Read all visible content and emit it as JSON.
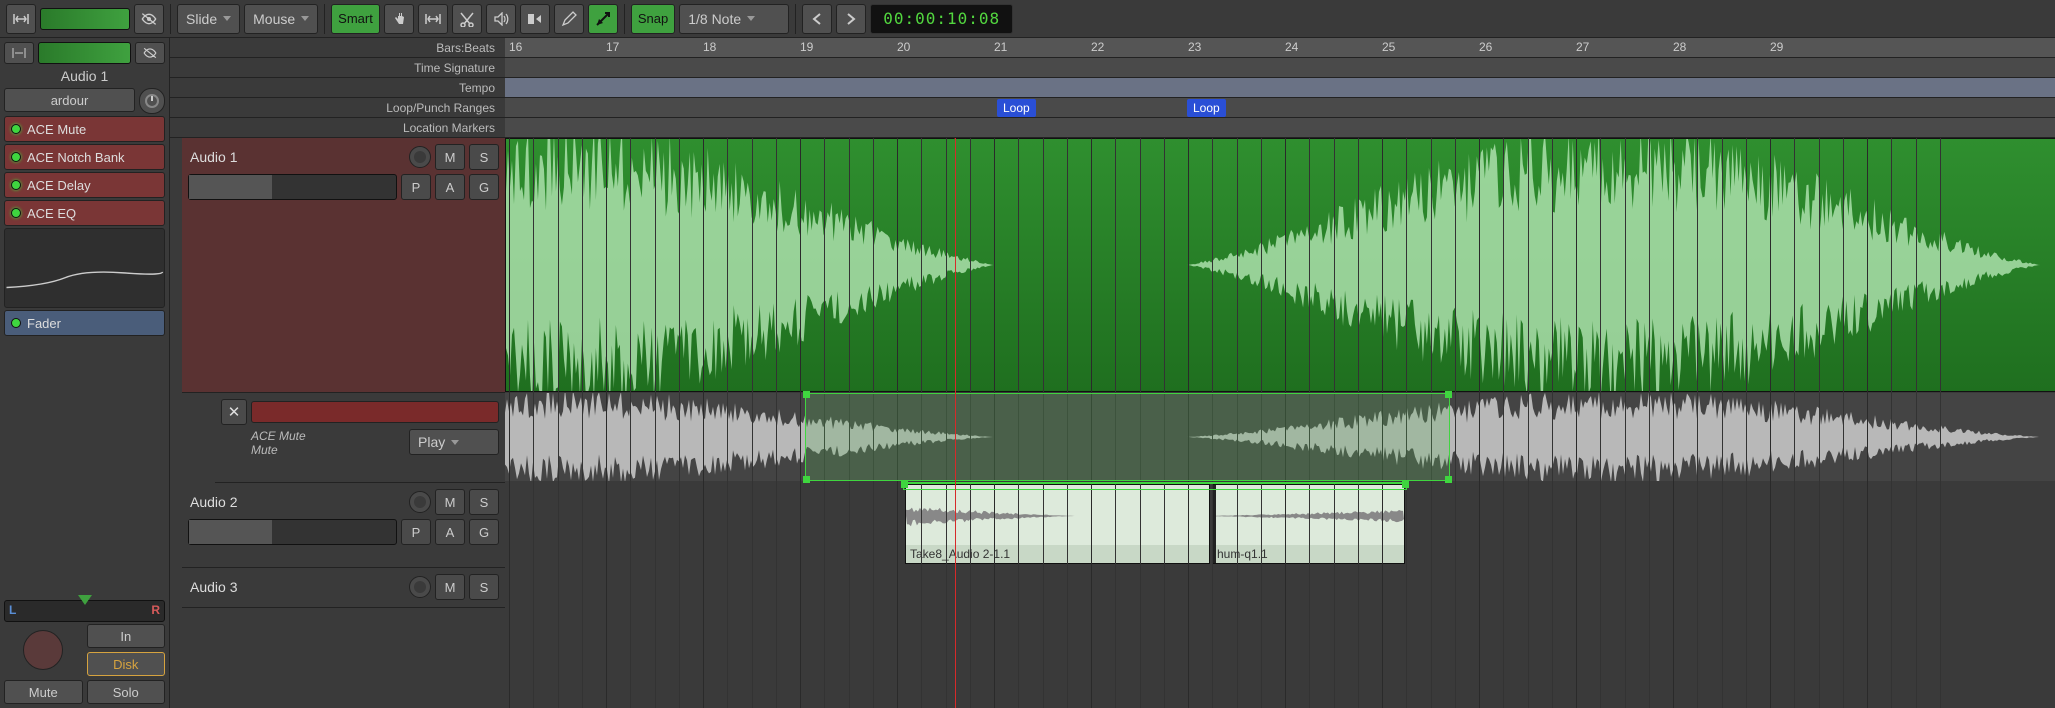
{
  "toolbar": {
    "zoom_mode": "Slide",
    "mouse_mode": "Mouse",
    "smart_label": "Smart",
    "snap_label": "Snap",
    "grid_value": "1/8 Note",
    "timecode": "00:00:10:08"
  },
  "sidebar": {
    "track_title": "Audio 1",
    "group_label": "ardour",
    "plugins": [
      "ACE Mute",
      "ACE Notch Bank",
      "ACE Delay",
      "ACE EQ"
    ],
    "fader_label": "Fader",
    "pan_L": "L",
    "pan_R": "R",
    "in_label": "In",
    "disk_label": "Disk",
    "mute_label": "Mute",
    "solo_label": "Solo"
  },
  "rulers": {
    "barsbeats": "Bars:Beats",
    "timesig": "Time Signature",
    "tempo": "Tempo",
    "looppunch": "Loop/Punch Ranges",
    "location": "Location Markers",
    "bars": [
      "16",
      "17",
      "18",
      "19",
      "20",
      "21",
      "22",
      "23",
      "24",
      "25",
      "26",
      "27",
      "28",
      "29"
    ],
    "loop_markers": [
      "Loop",
      "Loop"
    ]
  },
  "tracks": {
    "audio1": {
      "name": "Audio 1",
      "m": "M",
      "s": "S",
      "p": "P",
      "a": "A",
      "g": "G"
    },
    "plugin_panel": {
      "title1": "ACE Mute",
      "title2": "Mute",
      "play_label": "Play"
    },
    "audio2": {
      "name": "Audio 2",
      "m": "M",
      "s": "S",
      "p": "P",
      "a": "A",
      "g": "G",
      "clip1": "Take8_Audio 2-1.1",
      "clip2": "hum-q1.1"
    },
    "audio3": {
      "name": "Audio 3",
      "m": "M",
      "s": "S"
    }
  }
}
